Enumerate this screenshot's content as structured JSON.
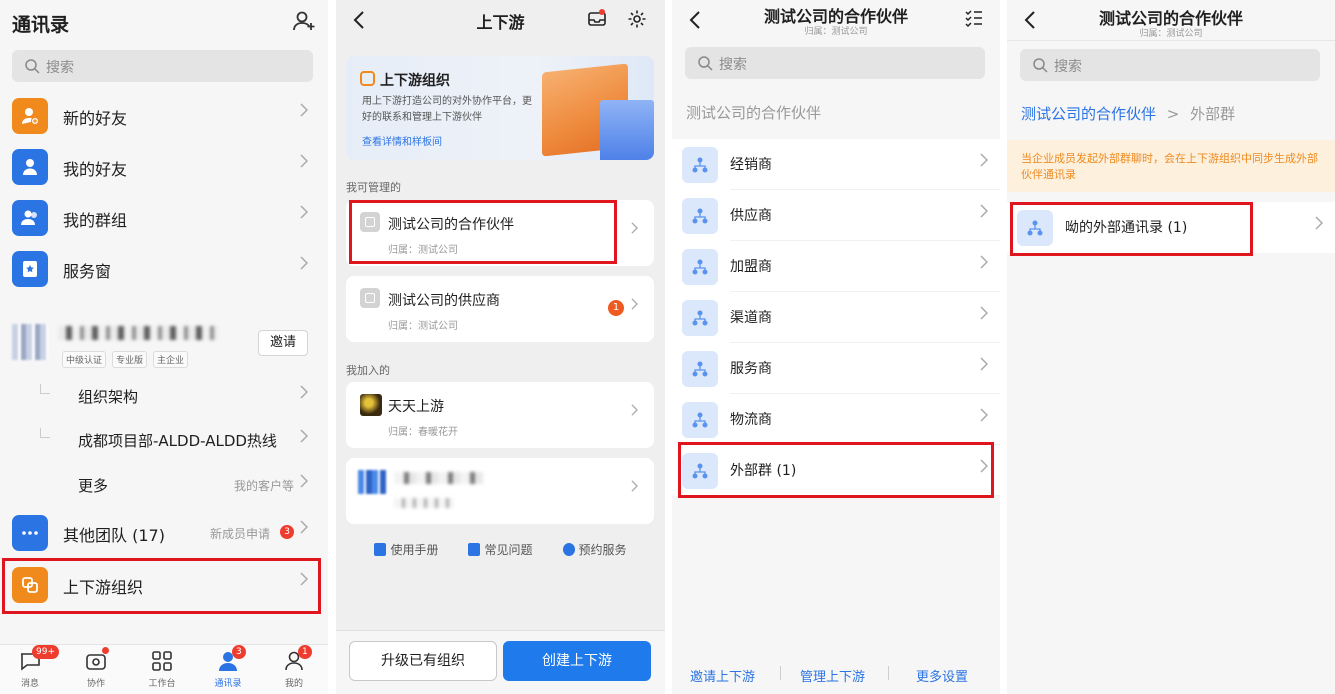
{
  "screen1": {
    "title": "通讯录",
    "search_placeholder": "搜索",
    "menu": [
      {
        "label": "新的好友"
      },
      {
        "label": "我的好友"
      },
      {
        "label": "我的群组"
      },
      {
        "label": "服务窗"
      }
    ],
    "org": {
      "invite_label": "邀请",
      "badges": [
        "中级认证",
        "专业版",
        "主企业"
      ]
    },
    "sub_items": [
      {
        "label": "组织架构",
        "hint": ""
      },
      {
        "label": "成都项目部-ALDD-ALDD热线",
        "hint": ""
      },
      {
        "label": "更多",
        "hint": "我的客户等"
      }
    ],
    "other_teams": {
      "label": "其他团队 (17)",
      "hint": "新成员申请",
      "badge": "3"
    },
    "upstream": {
      "label": "上下游组织"
    },
    "tabs": [
      {
        "label": "消息",
        "badge": "99+"
      },
      {
        "label": "协作",
        "badge": ""
      },
      {
        "label": "工作台",
        "badge": ""
      },
      {
        "label": "通讯录",
        "badge": "3"
      },
      {
        "label": "我的",
        "badge": "1"
      }
    ]
  },
  "screen2": {
    "title": "上下游",
    "banner": {
      "title": "上下游组织",
      "desc": "用上下游打造公司的对外协作平台，更好的联系和管理上下游伙伴",
      "link": "查看详情和样板间"
    },
    "manage_label": "我可管理的",
    "managed": [
      {
        "title": "测试公司的合作伙伴",
        "sub": "归属：测试公司",
        "badge": ""
      },
      {
        "title": "测试公司的供应商",
        "sub": "归属：测试公司",
        "badge": "1"
      }
    ],
    "joined_label": "我加入的",
    "joined": [
      {
        "title": "天天上游",
        "sub": "归属：春暖花开"
      }
    ],
    "links": [
      "使用手册",
      "常见问题",
      "预约服务"
    ],
    "btn_upgrade": "升级已有组织",
    "btn_create": "创建上下游"
  },
  "screen3": {
    "title": "测试公司的合作伙伴",
    "subtitle": "归属：测试公司",
    "search_placeholder": "搜索",
    "group_label": "测试公司的合作伙伴",
    "items": [
      "经销商",
      "供应商",
      "加盟商",
      "渠道商",
      "服务商",
      "物流商",
      "外部群 (1)"
    ],
    "footer": [
      "邀请上下游",
      "管理上下游",
      "更多设置"
    ]
  },
  "screen4": {
    "title": "测试公司的合作伙伴",
    "subtitle": "归属：测试公司",
    "search_placeholder": "搜索",
    "crumb_root": "测试公司的合作伙伴",
    "crumb_sep": ">",
    "crumb_current": "外部群",
    "notice": "当企业成员发起外部群聊时，会在上下游组织中同步生成外部伙伴通讯录",
    "item": "呦的外部通讯录 (1)"
  },
  "colors": {
    "accent": "#2b74e3",
    "orange": "#f08a1c",
    "highlight": "#e0161e"
  }
}
